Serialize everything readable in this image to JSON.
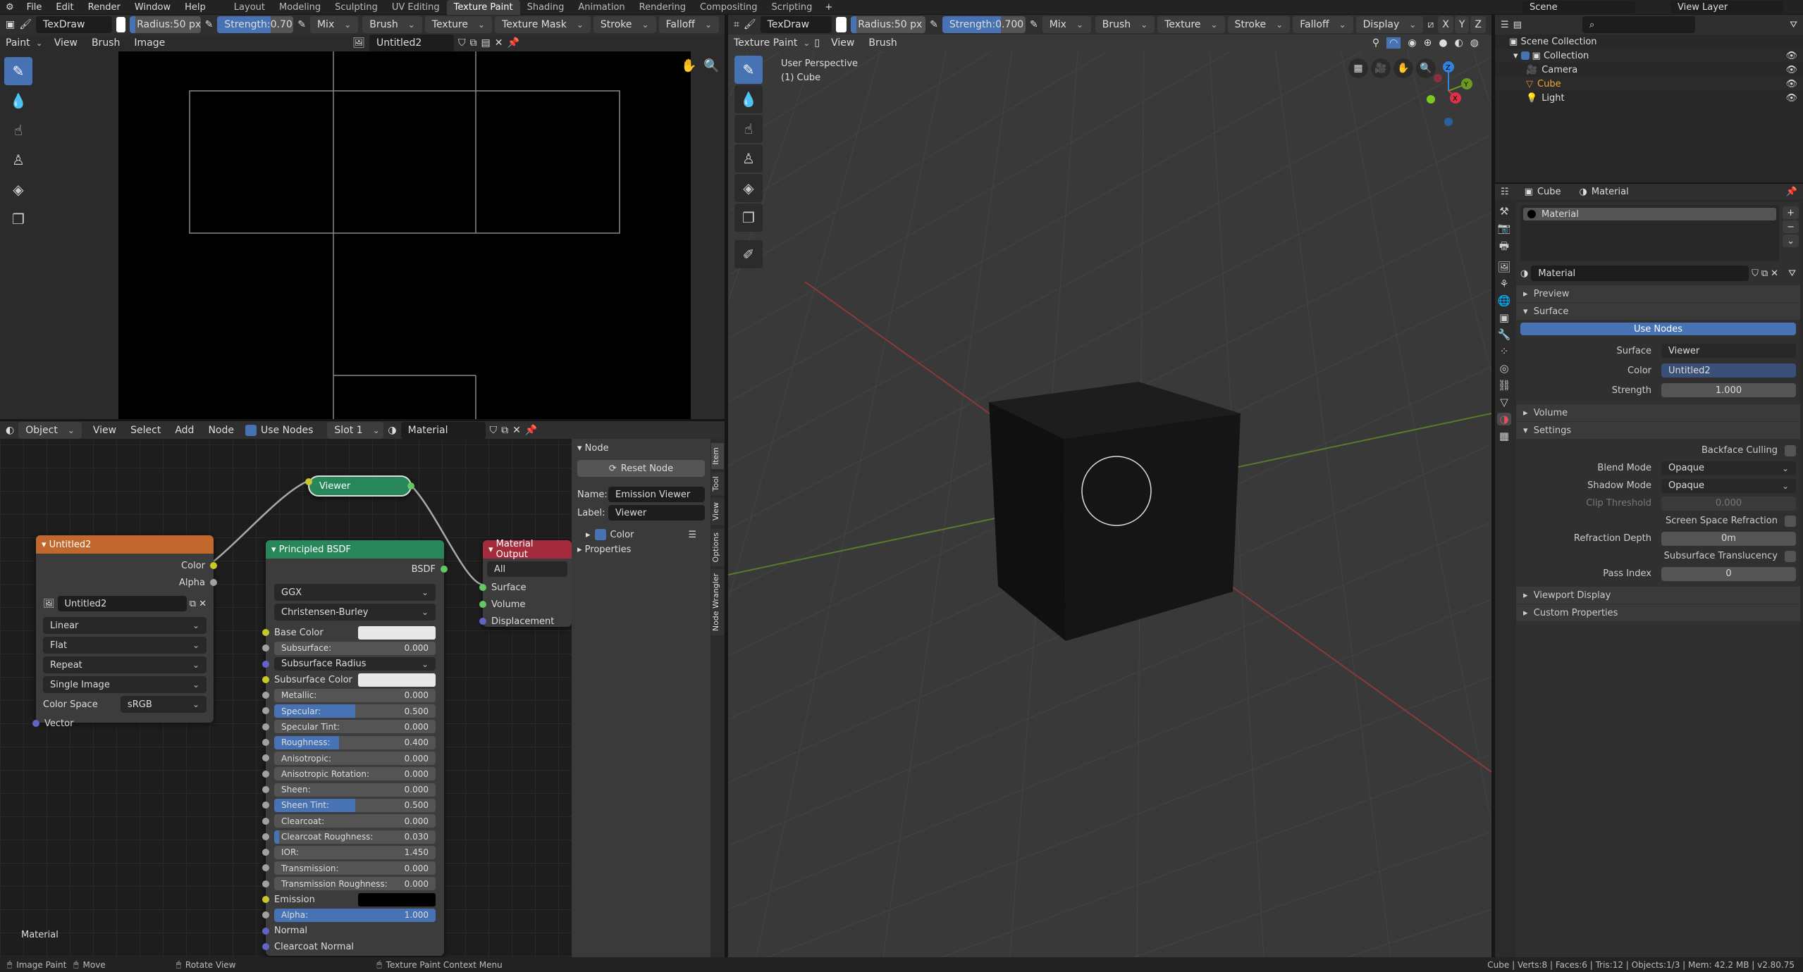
{
  "topbar": {
    "menus": [
      "File",
      "Edit",
      "Render",
      "Window",
      "Help"
    ],
    "workspaces": [
      "Layout",
      "Modeling",
      "Sculpting",
      "UV Editing",
      "Texture Paint",
      "Shading",
      "Animation",
      "Rendering",
      "Compositing",
      "Scripting"
    ],
    "active": "Texture Paint",
    "scene": "Scene",
    "view_layer": "View Layer"
  },
  "image_editor": {
    "brush": "TexDraw",
    "radius_label": "Radius:",
    "radius": "50 px",
    "strength_label": "Strength:",
    "strength": "0.700",
    "strength_fraction": 0.7,
    "blend": "Mix",
    "dropdowns": [
      "Brush",
      "Texture",
      "Texture Mask",
      "Stroke",
      "Falloff"
    ],
    "mode": "Paint",
    "menus": [
      "View",
      "Brush",
      "Image"
    ],
    "image": "Untitled2"
  },
  "viewport": {
    "brush": "TexDraw",
    "radius_label": "Radius:",
    "radius": "50 px",
    "strength_label": "Strength:",
    "strength": "0.700",
    "blend": "Mix",
    "dropdowns": [
      "Brush",
      "Texture",
      "Stroke",
      "Falloff",
      "Display"
    ],
    "axes": [
      "X",
      "Y",
      "Z"
    ],
    "mode": "Texture Paint",
    "menus": [
      "View",
      "Brush"
    ],
    "overlay_title": "User Perspective",
    "overlay_object": "(1) Cube",
    "gizmo": {
      "x": "X",
      "y": "Y",
      "z": "Z"
    }
  },
  "node_editor": {
    "object": "Object",
    "menus": [
      "View",
      "Select",
      "Add",
      "Node"
    ],
    "use_nodes": "Use Nodes",
    "slot": "Slot 1",
    "material": "Material",
    "footer_label": "Material",
    "image_node": {
      "title": "Untitled2",
      "outputs": [
        "Color",
        "Alpha"
      ],
      "image": "Untitled2",
      "interpolation": "Linear",
      "projection": "Flat",
      "extension": "Repeat",
      "source": "Single Image",
      "color_space_label": "Color Space",
      "color_space": "sRGB",
      "input": "Vector"
    },
    "viewer_node": {
      "title": "Viewer"
    },
    "bsdf": {
      "title": "Principled BSDF",
      "output": "BSDF",
      "distribution": "GGX",
      "subsurface_method": "Christensen-Burley",
      "inputs": [
        {
          "type": "color",
          "label": "Base Color",
          "color": "#e8e8e8",
          "sock": "#c7c729"
        },
        {
          "type": "slider",
          "label": "Subsurface:",
          "value": "0.000",
          "fill": 0,
          "sock": "#a1a1a1"
        },
        {
          "type": "dropdown",
          "label": "Subsurface Radius",
          "sock": "#6363c7"
        },
        {
          "type": "color",
          "label": "Subsurface Color",
          "color": "#e8e8e8",
          "sock": "#c7c729"
        },
        {
          "type": "slider",
          "label": "Metallic:",
          "value": "0.000",
          "fill": 0,
          "sock": "#a1a1a1"
        },
        {
          "type": "slider",
          "label": "Specular:",
          "value": "0.500",
          "fill": 0.5,
          "sock": "#a1a1a1"
        },
        {
          "type": "slider",
          "label": "Specular Tint:",
          "value": "0.000",
          "fill": 0,
          "sock": "#a1a1a1"
        },
        {
          "type": "slider",
          "label": "Roughness:",
          "value": "0.400",
          "fill": 0.4,
          "sock": "#a1a1a1"
        },
        {
          "type": "slider",
          "label": "Anisotropic:",
          "value": "0.000",
          "fill": 0,
          "sock": "#a1a1a1"
        },
        {
          "type": "slider",
          "label": "Anisotropic Rotation:",
          "value": "0.000",
          "fill": 0,
          "sock": "#a1a1a1"
        },
        {
          "type": "slider",
          "label": "Sheen:",
          "value": "0.000",
          "fill": 0,
          "sock": "#a1a1a1"
        },
        {
          "type": "slider",
          "label": "Sheen Tint:",
          "value": "0.500",
          "fill": 0.5,
          "sock": "#a1a1a1"
        },
        {
          "type": "slider",
          "label": "Clearcoat:",
          "value": "0.000",
          "fill": 0,
          "sock": "#a1a1a1"
        },
        {
          "type": "slider",
          "label": "Clearcoat Roughness:",
          "value": "0.030",
          "fill": 0.03,
          "sock": "#a1a1a1"
        },
        {
          "type": "slider",
          "label": "IOR:",
          "value": "1.450",
          "fill": 0,
          "sock": "#a1a1a1"
        },
        {
          "type": "slider",
          "label": "Transmission:",
          "value": "0.000",
          "fill": 0,
          "sock": "#a1a1a1"
        },
        {
          "type": "slider",
          "label": "Transmission Roughness:",
          "value": "0.000",
          "fill": 0,
          "sock": "#a1a1a1"
        },
        {
          "type": "color",
          "label": "Emission",
          "color": "#000000",
          "sock": "#c7c729"
        },
        {
          "type": "slider",
          "label": "Alpha:",
          "value": "1.000",
          "fill": 1,
          "sock": "#a1a1a1"
        },
        {
          "type": "plain",
          "label": "Normal",
          "sock": "#6363c7"
        },
        {
          "type": "plain",
          "label": "Clearcoat Normal",
          "sock": "#6363c7"
        }
      ]
    },
    "output_node": {
      "title": "Material Output",
      "target": "All",
      "inputs": [
        "Surface",
        "Volume",
        "Displacement"
      ]
    },
    "sidebar": {
      "section": "Node",
      "reset": "Reset Node",
      "name_label": "Name:",
      "name": "Emission Viewer",
      "label_label": "Label:",
      "label": "Viewer",
      "color": "Color",
      "properties": "Properties",
      "tabs": [
        "Item",
        "Tool",
        "View",
        "Options",
        "Node Wrangler"
      ]
    }
  },
  "outliner": {
    "root": "Scene Collection",
    "collection": "Collection",
    "items": [
      {
        "name": "Camera",
        "icon": "camera-icon"
      },
      {
        "name": "Cube",
        "icon": "mesh-icon",
        "active": true
      },
      {
        "name": "Light",
        "icon": "light-icon"
      }
    ]
  },
  "properties": {
    "object": "Cube",
    "material_tab": "Material",
    "slot": "Material",
    "material": "Material",
    "preview": "Preview",
    "surface_section": "Surface",
    "use_nodes": "Use Nodes",
    "surface_rows": [
      {
        "label": "Surface",
        "value": "Viewer"
      },
      {
        "label": "Color",
        "value": "Untitled2"
      },
      {
        "label": "Strength",
        "value": "1.000"
      }
    ],
    "volume": "Volume",
    "settings": "Settings",
    "settings_rows": [
      {
        "type": "check",
        "label": "Backface Culling"
      },
      {
        "type": "dd",
        "label": "Blend Mode",
        "value": "Opaque"
      },
      {
        "type": "dd",
        "label": "Shadow Mode",
        "value": "Opaque"
      },
      {
        "type": "num",
        "label": "Clip Threshold",
        "value": "0.000",
        "disabled": true
      },
      {
        "type": "check",
        "label": "Screen Space Refraction"
      },
      {
        "type": "num",
        "label": "Refraction Depth",
        "value": "0m"
      },
      {
        "type": "check",
        "label": "Subsurface Translucency"
      },
      {
        "type": "num",
        "label": "Pass Index",
        "value": "0"
      }
    ],
    "viewport_display": "Viewport Display",
    "custom_properties": "Custom Properties"
  },
  "statusbar": {
    "items": [
      "Image Paint",
      "Move",
      "Rotate View",
      "Texture Paint Context Menu"
    ],
    "stats": "Cube | Verts:8 | Faces:6 | Tris:12 | Objects:1/3 | Mem: 42.2 MB | v2.80.75"
  },
  "colors": {
    "accent": "#4772b3",
    "image_node": "#c2672d",
    "shader_node": "#27875a",
    "output_node": "#a42b3b"
  }
}
